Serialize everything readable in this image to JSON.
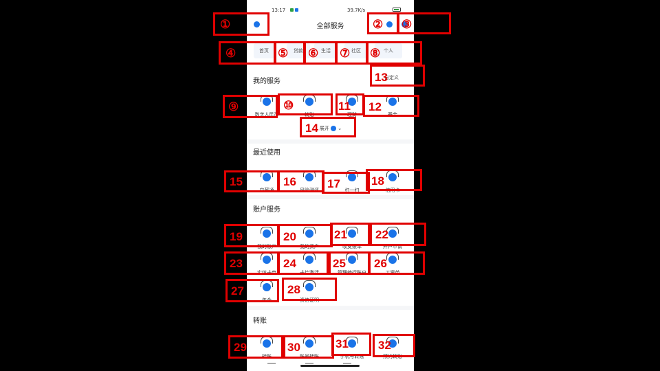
{
  "status_bar": {
    "time": "13:17",
    "network_speed": "39.7K/s"
  },
  "header": {
    "title": "全部服务"
  },
  "tabs": [
    "首页",
    "贷款",
    "生活",
    "社区",
    "个人"
  ],
  "my_services": {
    "title": "我的服务",
    "customize_label": "自定义",
    "items": [
      "数字人民币",
      "转账",
      "理财",
      "基金"
    ],
    "more_label": "展开"
  },
  "recent": {
    "title": "最近使用",
    "items": [
      "交薪通",
      "风险测评",
      "扫一扫",
      "信用卡"
    ]
  },
  "account_services": {
    "title": "账户服务",
    "items": [
      "我的账户",
      "我的资产",
      "收支账本",
      "开户申请",
      "实体卡申",
      "卡片激活",
      "管理他行账户",
      "工资单",
      "年金",
      "资信证明"
    ]
  },
  "transfer": {
    "title": "转账",
    "items": [
      "转账",
      "账号转账",
      "手机号转账",
      "预约转账"
    ]
  },
  "annotations": {
    "labels": [
      "①",
      "②",
      "③",
      "④",
      "⑤",
      "⑥",
      "⑦",
      "⑧",
      "⑨",
      "⑩",
      "11",
      "12",
      "13",
      "14",
      "15",
      "16",
      "17",
      "18",
      "19",
      "20",
      "21",
      "22",
      "23",
      "24",
      "25",
      "26",
      "27",
      "28",
      "29",
      "30",
      "31",
      "32"
    ]
  },
  "colors": {
    "annotation": "#e00000",
    "accent": "#1a73e8"
  }
}
